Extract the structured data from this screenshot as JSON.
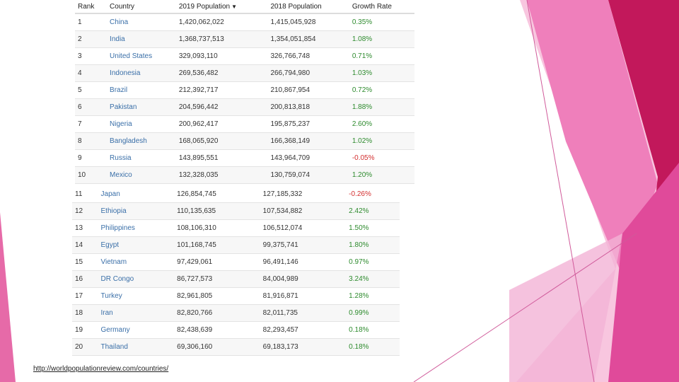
{
  "table_top": {
    "headers": {
      "rank": "Rank",
      "country": "Country",
      "pop2019": "2019 Population",
      "pop2018": "2018 Population",
      "growth": "Growth Rate"
    },
    "rows": [
      {
        "rank": "1",
        "country": "China",
        "pop2019": "1,420,062,022",
        "pop2018": "1,415,045,928",
        "growth": "0.35%"
      },
      {
        "rank": "2",
        "country": "India",
        "pop2019": "1,368,737,513",
        "pop2018": "1,354,051,854",
        "growth": "1.08%"
      },
      {
        "rank": "3",
        "country": "United States",
        "pop2019": "329,093,110",
        "pop2018": "326,766,748",
        "growth": "0.71%"
      },
      {
        "rank": "4",
        "country": "Indonesia",
        "pop2019": "269,536,482",
        "pop2018": "266,794,980",
        "growth": "1.03%"
      },
      {
        "rank": "5",
        "country": "Brazil",
        "pop2019": "212,392,717",
        "pop2018": "210,867,954",
        "growth": "0.72%"
      },
      {
        "rank": "6",
        "country": "Pakistan",
        "pop2019": "204,596,442",
        "pop2018": "200,813,818",
        "growth": "1.88%"
      },
      {
        "rank": "7",
        "country": "Nigeria",
        "pop2019": "200,962,417",
        "pop2018": "195,875,237",
        "growth": "2.60%"
      },
      {
        "rank": "8",
        "country": "Bangladesh",
        "pop2019": "168,065,920",
        "pop2018": "166,368,149",
        "growth": "1.02%"
      },
      {
        "rank": "9",
        "country": "Russia",
        "pop2019": "143,895,551",
        "pop2018": "143,964,709",
        "growth": "-0.05%"
      },
      {
        "rank": "10",
        "country": "Mexico",
        "pop2019": "132,328,035",
        "pop2018": "130,759,074",
        "growth": "1.20%"
      }
    ]
  },
  "table_bottom": {
    "rows": [
      {
        "rank": "11",
        "country": "Japan",
        "pop2019": "126,854,745",
        "pop2018": "127,185,332",
        "growth": "-0.26%"
      },
      {
        "rank": "12",
        "country": "Ethiopia",
        "pop2019": "110,135,635",
        "pop2018": "107,534,882",
        "growth": "2.42%"
      },
      {
        "rank": "13",
        "country": "Philippines",
        "pop2019": "108,106,310",
        "pop2018": "106,512,074",
        "growth": "1.50%"
      },
      {
        "rank": "14",
        "country": "Egypt",
        "pop2019": "101,168,745",
        "pop2018": "99,375,741",
        "growth": "1.80%"
      },
      {
        "rank": "15",
        "country": "Vietnam",
        "pop2019": "97,429,061",
        "pop2018": "96,491,146",
        "growth": "0.97%"
      },
      {
        "rank": "16",
        "country": "DR Congo",
        "pop2019": "86,727,573",
        "pop2018": "84,004,989",
        "growth": "3.24%"
      },
      {
        "rank": "17",
        "country": "Turkey",
        "pop2019": "82,961,805",
        "pop2018": "81,916,871",
        "growth": "1.28%"
      },
      {
        "rank": "18",
        "country": "Iran",
        "pop2019": "82,820,766",
        "pop2018": "82,011,735",
        "growth": "0.99%"
      },
      {
        "rank": "19",
        "country": "Germany",
        "pop2019": "82,438,639",
        "pop2018": "82,293,457",
        "growth": "0.18%"
      },
      {
        "rank": "20",
        "country": "Thailand",
        "pop2019": "69,306,160",
        "pop2018": "69,183,173",
        "growth": "0.18%"
      }
    ]
  },
  "source_link": "http://worldpopulationreview.com/countries/",
  "colors": {
    "positive": "#2e8b2e",
    "negative": "#d32f2f",
    "link": "#3a6fa8",
    "pink_dark": "#c2185b",
    "pink_mid": "#e55aa5",
    "pink_light": "#f5a9d0"
  }
}
